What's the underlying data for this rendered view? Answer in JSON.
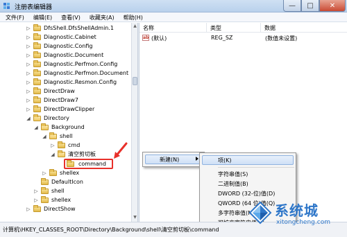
{
  "window": {
    "title": "注册表编辑器",
    "minimize_glyph": "—",
    "maximize_glyph": "□",
    "close_glyph": "✕"
  },
  "menu": [
    "文件(F)",
    "编辑(E)",
    "查看(V)",
    "收藏夹(A)",
    "帮助(H)"
  ],
  "tree": {
    "items": [
      {
        "label": "DfsShell.DfsShellAdmin.1",
        "expander": "▷"
      },
      {
        "label": "Diagnostic.Cabinet",
        "expander": "▷"
      },
      {
        "label": "Diagnostic.Config",
        "expander": "▷"
      },
      {
        "label": "Diagnostic.Document",
        "expander": "▷"
      },
      {
        "label": "Diagnostic.Perfmon.Config",
        "expander": "▷"
      },
      {
        "label": "Diagnostic.Perfmon.Document",
        "expander": "▷"
      },
      {
        "label": "Diagnostic.Resmon.Config",
        "expander": "▷"
      },
      {
        "label": "DirectDraw",
        "expander": "▷"
      },
      {
        "label": "DirectDraw7",
        "expander": "▷"
      },
      {
        "label": "DirectDrawClipper",
        "expander": "▷"
      },
      {
        "label": "Directory",
        "expander": "◢"
      },
      {
        "label": "Background",
        "expander": "◢"
      },
      {
        "label": "shell",
        "expander": "◢"
      },
      {
        "label": "cmd",
        "expander": "▷"
      },
      {
        "label": "清空剪切板",
        "expander": "◢"
      },
      {
        "label": "command",
        "expander": ""
      },
      {
        "label": "shellex",
        "expander": "▷"
      },
      {
        "label": "DefaultIcon",
        "expander": ""
      },
      {
        "label": "shell",
        "expander": "▷"
      },
      {
        "label": "shellex",
        "expander": "▷"
      },
      {
        "label": "DirectShow",
        "expander": "▷"
      }
    ]
  },
  "list": {
    "headers": {
      "name": "名称",
      "type": "类型",
      "data": "数据"
    },
    "rows": [
      {
        "icon": "ab",
        "name": "(默认)",
        "type": "REG_SZ",
        "data": "(数值未设置)"
      }
    ]
  },
  "context_menu": {
    "new_label": "新建(N)"
  },
  "submenu": {
    "items": [
      "项(K)",
      "字符串值(S)",
      "二进制值(B)",
      "DWORD (32-位)值(D)",
      "QWORD (64 位)值(Q)",
      "多字符串值(M)",
      "可扩充字符串值(E)"
    ]
  },
  "status": {
    "path": "计算机\\HKEY_CLASSES_ROOT\\Directory\\Background\\shell\\清空剪切板\\command"
  },
  "watermark": {
    "title": "系统城",
    "url": "xitongcheng.com"
  },
  "colors": {
    "annotation_red": "#e8302a",
    "watermark_blue": "#2f77c9"
  }
}
